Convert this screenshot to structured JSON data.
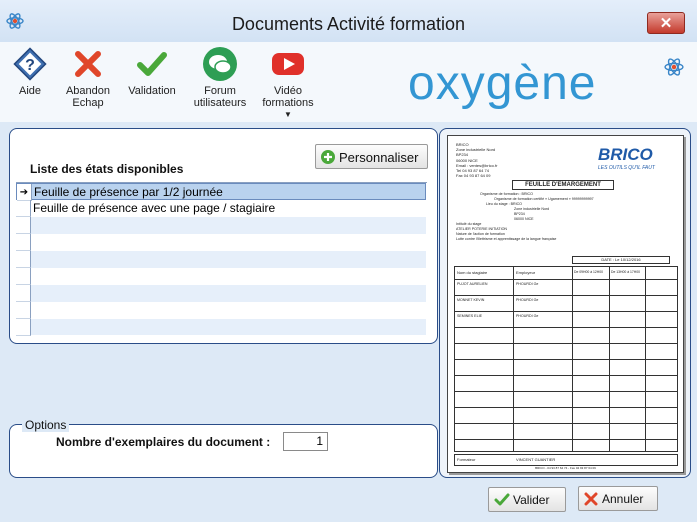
{
  "window": {
    "title": "Documents Activité formation"
  },
  "toolbar": {
    "aide": "Aide",
    "abandon_l1": "Abandon",
    "abandon_l2": "Echap",
    "validation": "Validation",
    "forum_l1": "Forum",
    "forum_l2": "utilisateurs",
    "video_l1": "Vidéo",
    "video_l2": "formations"
  },
  "brand": {
    "logo": "oxygène"
  },
  "states": {
    "heading": "Liste des états disponibles",
    "personnaliser_label": "Personnaliser",
    "rows": [
      "Feuille de présence par 1/2 journée",
      "Feuille de présence avec une page / stagiaire",
      "",
      "",
      "",
      "",
      "",
      ""
    ],
    "selected_index": 0
  },
  "options": {
    "legend": "Options",
    "copies_label": "Nombre d'exemplaires du document :",
    "copies_value": "1"
  },
  "preview": {
    "org_lines": [
      "BRICO",
      "Zone industrielle Nord",
      "BP234",
      "06000 NICE",
      "Email : ventes@brico.fr",
      "Tel 04 93 87 64 74",
      "Fax 04 93 87 64 09"
    ],
    "brand_text": "BRICO",
    "brand_tagline": "LES OUTILS QU'IL FAUT",
    "sheet_title": "FEUILLE D'EMARGEMENT",
    "info_lines": [
      "Organisme de formation : BRICO",
      "Organisme de formation certifié « Ugamement » 99999999997",
      "Lieu du stage : BRICO",
      "Zone industrielle Nord",
      "BP234",
      "06000 NICE",
      "Intitulé du stage",
      "ATELIER POTERIE INITIATION",
      "Nature de l'action de formation",
      "Lutte contre l'illettrisme et apprentissage de la langue française"
    ],
    "date_label": "DATE : Le 10/12/2016",
    "col_name": "Nom du stagiaire",
    "col_employer": "Employeur",
    "col_am": "De 09H00 à 12H00",
    "col_pm": "De 13H00 à 17H00",
    "trainees": [
      {
        "name": "PUJOT AURELIEN",
        "employer": "PHOURDI Ge"
      },
      {
        "name": "MONNET KEVIN",
        "employer": "PHOURDI Ge"
      },
      {
        "name": "SEMINES ELIE",
        "employer": "PHOURDI Ge"
      }
    ],
    "formateur_label": "Formateur",
    "formateur_name": "VINCENT GUANTIER",
    "footer": "BRICO - 04 93 87 64 74 - Fax 04 93 87 64 09"
  },
  "actions": {
    "valider_label": "Valider",
    "annuler_label": "Annuler"
  }
}
